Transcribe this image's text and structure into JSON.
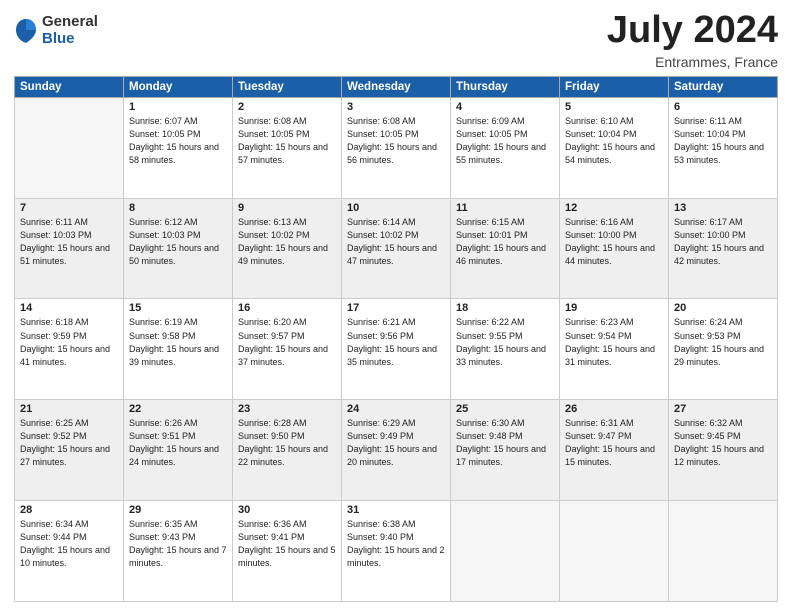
{
  "logo": {
    "general": "General",
    "blue": "Blue"
  },
  "title": "July 2024",
  "location": "Entrammes, France",
  "days_of_week": [
    "Sunday",
    "Monday",
    "Tuesday",
    "Wednesday",
    "Thursday",
    "Friday",
    "Saturday"
  ],
  "weeks": [
    [
      {
        "num": "",
        "empty": true
      },
      {
        "num": "1",
        "sunrise": "Sunrise: 6:07 AM",
        "sunset": "Sunset: 10:05 PM",
        "daylight": "Daylight: 15 hours and 58 minutes."
      },
      {
        "num": "2",
        "sunrise": "Sunrise: 6:08 AM",
        "sunset": "Sunset: 10:05 PM",
        "daylight": "Daylight: 15 hours and 57 minutes."
      },
      {
        "num": "3",
        "sunrise": "Sunrise: 6:08 AM",
        "sunset": "Sunset: 10:05 PM",
        "daylight": "Daylight: 15 hours and 56 minutes."
      },
      {
        "num": "4",
        "sunrise": "Sunrise: 6:09 AM",
        "sunset": "Sunset: 10:05 PM",
        "daylight": "Daylight: 15 hours and 55 minutes."
      },
      {
        "num": "5",
        "sunrise": "Sunrise: 6:10 AM",
        "sunset": "Sunset: 10:04 PM",
        "daylight": "Daylight: 15 hours and 54 minutes."
      },
      {
        "num": "6",
        "sunrise": "Sunrise: 6:11 AM",
        "sunset": "Sunset: 10:04 PM",
        "daylight": "Daylight: 15 hours and 53 minutes."
      }
    ],
    [
      {
        "num": "7",
        "sunrise": "Sunrise: 6:11 AM",
        "sunset": "Sunset: 10:03 PM",
        "daylight": "Daylight: 15 hours and 51 minutes."
      },
      {
        "num": "8",
        "sunrise": "Sunrise: 6:12 AM",
        "sunset": "Sunset: 10:03 PM",
        "daylight": "Daylight: 15 hours and 50 minutes."
      },
      {
        "num": "9",
        "sunrise": "Sunrise: 6:13 AM",
        "sunset": "Sunset: 10:02 PM",
        "daylight": "Daylight: 15 hours and 49 minutes."
      },
      {
        "num": "10",
        "sunrise": "Sunrise: 6:14 AM",
        "sunset": "Sunset: 10:02 PM",
        "daylight": "Daylight: 15 hours and 47 minutes."
      },
      {
        "num": "11",
        "sunrise": "Sunrise: 6:15 AM",
        "sunset": "Sunset: 10:01 PM",
        "daylight": "Daylight: 15 hours and 46 minutes."
      },
      {
        "num": "12",
        "sunrise": "Sunrise: 6:16 AM",
        "sunset": "Sunset: 10:00 PM",
        "daylight": "Daylight: 15 hours and 44 minutes."
      },
      {
        "num": "13",
        "sunrise": "Sunrise: 6:17 AM",
        "sunset": "Sunset: 10:00 PM",
        "daylight": "Daylight: 15 hours and 42 minutes."
      }
    ],
    [
      {
        "num": "14",
        "sunrise": "Sunrise: 6:18 AM",
        "sunset": "Sunset: 9:59 PM",
        "daylight": "Daylight: 15 hours and 41 minutes."
      },
      {
        "num": "15",
        "sunrise": "Sunrise: 6:19 AM",
        "sunset": "Sunset: 9:58 PM",
        "daylight": "Daylight: 15 hours and 39 minutes."
      },
      {
        "num": "16",
        "sunrise": "Sunrise: 6:20 AM",
        "sunset": "Sunset: 9:57 PM",
        "daylight": "Daylight: 15 hours and 37 minutes."
      },
      {
        "num": "17",
        "sunrise": "Sunrise: 6:21 AM",
        "sunset": "Sunset: 9:56 PM",
        "daylight": "Daylight: 15 hours and 35 minutes."
      },
      {
        "num": "18",
        "sunrise": "Sunrise: 6:22 AM",
        "sunset": "Sunset: 9:55 PM",
        "daylight": "Daylight: 15 hours and 33 minutes."
      },
      {
        "num": "19",
        "sunrise": "Sunrise: 6:23 AM",
        "sunset": "Sunset: 9:54 PM",
        "daylight": "Daylight: 15 hours and 31 minutes."
      },
      {
        "num": "20",
        "sunrise": "Sunrise: 6:24 AM",
        "sunset": "Sunset: 9:53 PM",
        "daylight": "Daylight: 15 hours and 29 minutes."
      }
    ],
    [
      {
        "num": "21",
        "sunrise": "Sunrise: 6:25 AM",
        "sunset": "Sunset: 9:52 PM",
        "daylight": "Daylight: 15 hours and 27 minutes."
      },
      {
        "num": "22",
        "sunrise": "Sunrise: 6:26 AM",
        "sunset": "Sunset: 9:51 PM",
        "daylight": "Daylight: 15 hours and 24 minutes."
      },
      {
        "num": "23",
        "sunrise": "Sunrise: 6:28 AM",
        "sunset": "Sunset: 9:50 PM",
        "daylight": "Daylight: 15 hours and 22 minutes."
      },
      {
        "num": "24",
        "sunrise": "Sunrise: 6:29 AM",
        "sunset": "Sunset: 9:49 PM",
        "daylight": "Daylight: 15 hours and 20 minutes."
      },
      {
        "num": "25",
        "sunrise": "Sunrise: 6:30 AM",
        "sunset": "Sunset: 9:48 PM",
        "daylight": "Daylight: 15 hours and 17 minutes."
      },
      {
        "num": "26",
        "sunrise": "Sunrise: 6:31 AM",
        "sunset": "Sunset: 9:47 PM",
        "daylight": "Daylight: 15 hours and 15 minutes."
      },
      {
        "num": "27",
        "sunrise": "Sunrise: 6:32 AM",
        "sunset": "Sunset: 9:45 PM",
        "daylight": "Daylight: 15 hours and 12 minutes."
      }
    ],
    [
      {
        "num": "28",
        "sunrise": "Sunrise: 6:34 AM",
        "sunset": "Sunset: 9:44 PM",
        "daylight": "Daylight: 15 hours and 10 minutes."
      },
      {
        "num": "29",
        "sunrise": "Sunrise: 6:35 AM",
        "sunset": "Sunset: 9:43 PM",
        "daylight": "Daylight: 15 hours and 7 minutes."
      },
      {
        "num": "30",
        "sunrise": "Sunrise: 6:36 AM",
        "sunset": "Sunset: 9:41 PM",
        "daylight": "Daylight: 15 hours and 5 minutes."
      },
      {
        "num": "31",
        "sunrise": "Sunrise: 6:38 AM",
        "sunset": "Sunset: 9:40 PM",
        "daylight": "Daylight: 15 hours and 2 minutes."
      },
      {
        "num": "",
        "empty": true
      },
      {
        "num": "",
        "empty": true
      },
      {
        "num": "",
        "empty": true
      }
    ]
  ]
}
